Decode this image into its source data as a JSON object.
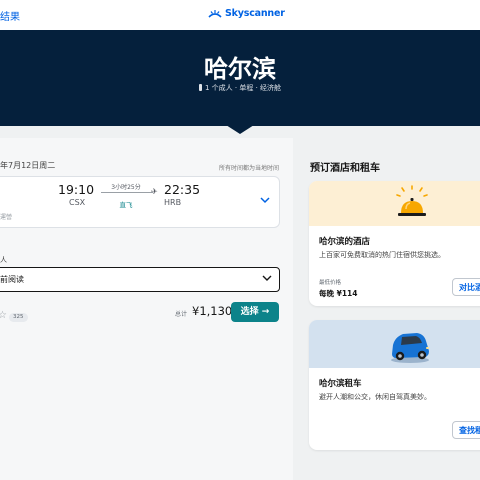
{
  "header": {
    "back_link": "结果",
    "brand": "Skyscanner",
    "city": "哈尔滨",
    "trip_meta": "1 个成人 · 单程 · 经济舱"
  },
  "flight": {
    "date": "年7月12日周二",
    "time_note": "所有时间都为当地时间",
    "depart_time": "19:10",
    "depart_code": "CSX",
    "duration": "3小时25分",
    "stops": "直飞",
    "arrive_time": "22:35",
    "arrive_code": "HRB",
    "card_sub": "運營"
  },
  "booking": {
    "pax_label": "人",
    "select_value": "前阅读",
    "rating_count": "325",
    "total_label": "总计",
    "total_price": "¥1,130",
    "select_button": "选择 →"
  },
  "sidebar": {
    "title": "预订酒店和租车",
    "hotel": {
      "title": "哈尔滨的酒店",
      "desc": "上百家可免费取消的热门住宿供您挑选。",
      "low_price_label": "最低价格",
      "low_price": "每晚 ¥114",
      "button": "对比酒"
    },
    "car": {
      "title": "哈尔滨租车",
      "desc": "避开人潮和公交，休闲自驾真美妙。",
      "button": "查找租"
    }
  },
  "colors": {
    "hero": "#05203c",
    "brand": "#0062e3",
    "accent": "#0c838a",
    "hotel_banner": "#fdefd4",
    "car_banner": "#d3e1ef"
  }
}
